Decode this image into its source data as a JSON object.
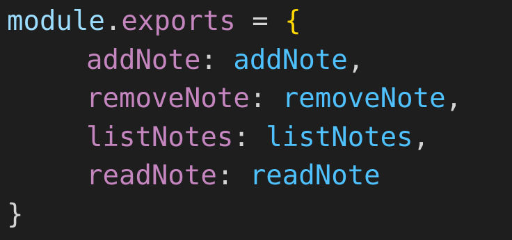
{
  "code": {
    "line1": {
      "object": "module",
      "dot": ".",
      "member": "exports",
      "operator": " = ",
      "open_brace": "{"
    },
    "entries": [
      {
        "key": "addNote",
        "colon": ": ",
        "value": "addNote",
        "comma": ","
      },
      {
        "key": "removeNote",
        "colon": ": ",
        "value": "removeNote",
        "comma": ","
      },
      {
        "key": "listNotes",
        "colon": ": ",
        "value": "listNotes",
        "comma": ","
      },
      {
        "key": "readNote",
        "colon": ": ",
        "value": "readNote",
        "comma": ""
      }
    ],
    "close_brace": "}"
  },
  "colors": {
    "background": "#1e1e1e",
    "identifier": "#9cdcfe",
    "property": "#c586c0",
    "value": "#4fc1ff",
    "brace": "#ffd700",
    "punctuation": "#d4d4d4"
  }
}
